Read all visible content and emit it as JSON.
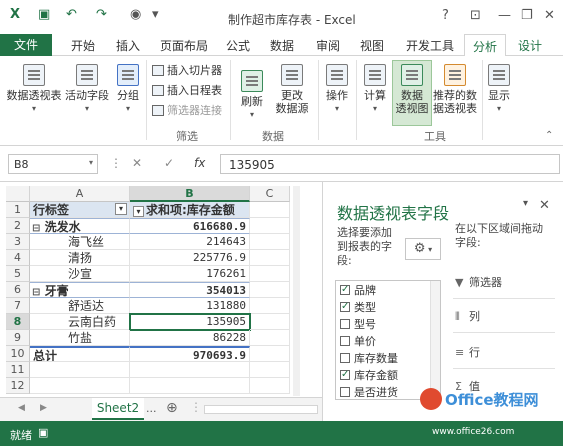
{
  "window": {
    "title": "制作超市库存表 - Excel",
    "help": "?",
    "ribbon_display": "⊡",
    "minimize": "—",
    "restore": "❐",
    "close": "✕"
  },
  "tabs": {
    "file": "文件",
    "home": "开始",
    "insert": "插入",
    "page_layout": "页面布局",
    "formulas": "公式",
    "data": "数据",
    "review": "审阅",
    "view": "视图",
    "developer": "开发工具",
    "analyze": "分析",
    "design": "设计"
  },
  "ribbon": {
    "pivot_table": "数据透视表",
    "active_field": "活动字段",
    "group": "分组",
    "insert_slicer": "插入切片器",
    "insert_timeline": "插入日程表",
    "filter_connections": "筛选器连接",
    "refresh": "刷新",
    "change_source_l1": "更改",
    "change_source_l2": "数据源",
    "actions": "操作",
    "calculations": "计算",
    "pivot_chart_l1": "数据",
    "pivot_chart_l2": "透视图",
    "recommended_l1": "推荐的数",
    "recommended_l2": "据透视表",
    "show": "显示",
    "group_filter": "筛选",
    "group_data": "数据",
    "group_tools": "工具"
  },
  "formula_bar": {
    "name_box": "B8",
    "cancel": "✕",
    "enter": "✓",
    "fx": "fx",
    "value": "135905"
  },
  "grid": {
    "col_a": "A",
    "col_b": "B",
    "col_c": "C",
    "rows": [
      "1",
      "2",
      "3",
      "4",
      "5",
      "6",
      "7",
      "8",
      "9",
      "10",
      "11",
      "12"
    ],
    "header_a": "行标签",
    "header_b": "求和项:库存金额",
    "r2a": "洗发水",
    "r2b": "616680.9",
    "r3a": "海飞丝",
    "r3b": "214643",
    "r4a": "清扬",
    "r4b": "225776.9",
    "r5a": "沙宣",
    "r5b": "176261",
    "r6a": "牙膏",
    "r6b": "354013",
    "r7a": "舒适达",
    "r7b": "131880",
    "r8a": "云南白药",
    "r8b": "135905",
    "r9a": "竹盐",
    "r9b": "86228",
    "r10a": "总计",
    "r10b": "970693.9",
    "collapse": "⊟"
  },
  "sheets": {
    "active": "Sheet2",
    "more": "...",
    "add": "⊕",
    "prev": "◀",
    "next": "▶"
  },
  "pane": {
    "title": "数据透视表字段",
    "choose_l1": "选择要添加",
    "choose_l2": "到报表的字",
    "choose_l3": "段:",
    "drag_l1": "在以下区域间拖动",
    "drag_l2": "字段:",
    "fields": [
      {
        "label": "品牌",
        "checked": true
      },
      {
        "label": "类型",
        "checked": true
      },
      {
        "label": "型号",
        "checked": false
      },
      {
        "label": "单价",
        "checked": false
      },
      {
        "label": "库存数量",
        "checked": false
      },
      {
        "label": "库存金额",
        "checked": true
      },
      {
        "label": "是否进货",
        "checked": false
      }
    ],
    "area_filters": "筛选器",
    "area_columns": "列",
    "area_rows": "行",
    "area_values": "值"
  },
  "status": {
    "ready": "就绪"
  },
  "watermark": {
    "brand": "Office教程网",
    "url": "www.office26.com"
  }
}
